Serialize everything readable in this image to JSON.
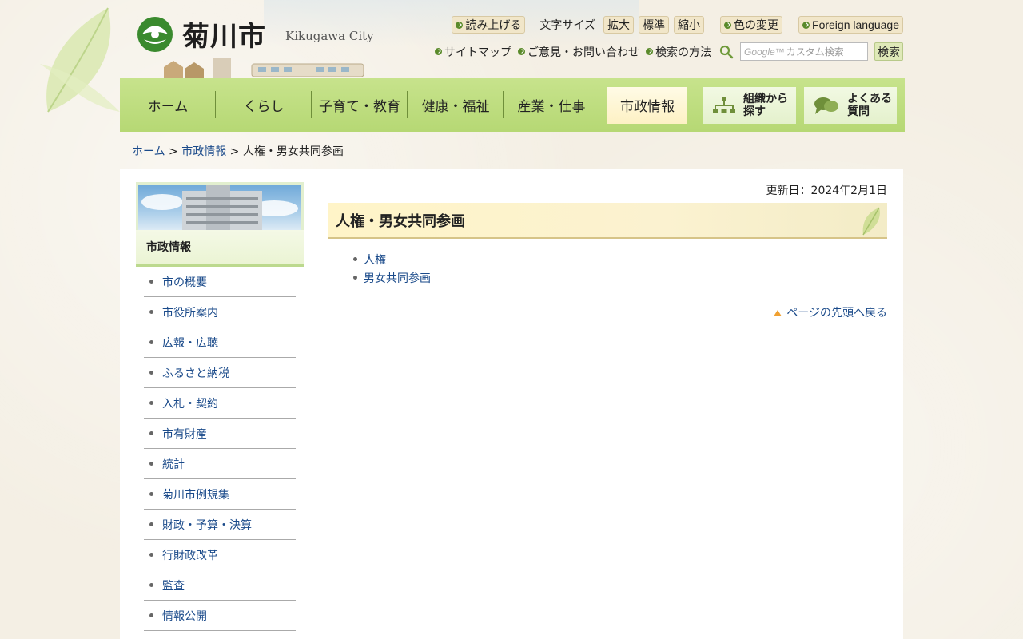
{
  "header": {
    "logo_text": "菊川市",
    "logo_sub": "Kikugawa City",
    "tools": {
      "read_aloud": "読み上げる",
      "font_size_label": "文字サイズ",
      "font_enlarge": "拡大",
      "font_standard": "標準",
      "font_shrink": "縮小",
      "color_change": "色の変更",
      "foreign_language": "Foreign language"
    },
    "links": {
      "sitemap": "サイトマップ",
      "feedback": "ご意見・お問い合わせ",
      "search_howto": "検索の方法"
    },
    "search": {
      "google_mark": "Google™",
      "placeholder": "カスタム検索",
      "button": "検索"
    }
  },
  "nav": {
    "items": [
      "ホーム",
      "くらし",
      "子育て・教育",
      "健康・福祉",
      "産業・仕事",
      "市政情報"
    ],
    "organization": "組織から\n探す",
    "faq": "よくある\n質問"
  },
  "breadcrumb": {
    "home": "ホーム",
    "sep1": " > ",
    "section": "市政情報",
    "sep2": " > ",
    "current": "人権・男女共同参画"
  },
  "sidebar": {
    "title": "市政情報",
    "items": [
      "市の概要",
      "市役所案内",
      "広報・広聴",
      "ふるさと納税",
      "入札・契約",
      "市有財産",
      "統計",
      "菊川市例規集",
      "財政・予算・決算",
      "行財政改革",
      "監査",
      "情報公開"
    ]
  },
  "main": {
    "updated": "更新日：2024年2月1日",
    "title": "人権・男女共同参画",
    "links": [
      "人権",
      "男女共同参画"
    ],
    "page_top": "ページの先頭へ戻る"
  },
  "colors": {
    "nav_green": "#b6d874",
    "link_blue": "#1a4a8a",
    "title_bg": "#fff4c8"
  }
}
